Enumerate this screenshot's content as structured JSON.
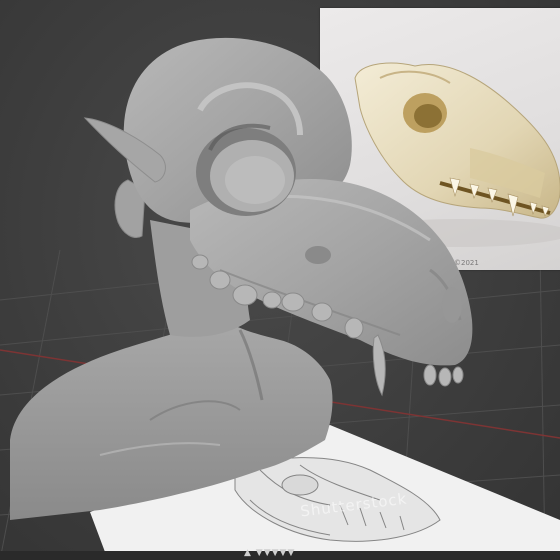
{
  "viewport": {
    "title": "",
    "background_color": "#3c3c3c",
    "grid_color": "#555555",
    "axis_red_color": "#8f3a3a"
  },
  "reference_photo": {
    "subject": "canine skull photograph",
    "copyright_text": "©2021"
  },
  "reference_sheet": {
    "subject": "skull sketch reference",
    "watermark_text": "Shutterstock"
  },
  "model": {
    "subject": "sculpted bust with animal skull head",
    "material_color": "#a9a9a9"
  },
  "status_bar": {
    "text": "▲ ▼▼▼▼▼"
  }
}
